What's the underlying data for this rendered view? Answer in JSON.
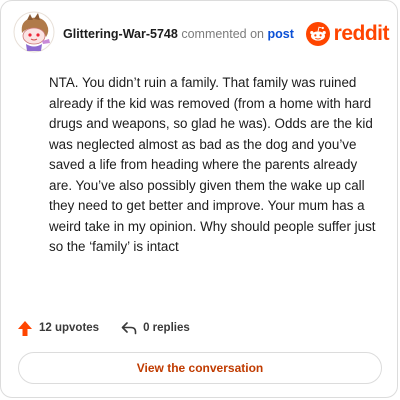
{
  "header": {
    "username": "Glittering-War-5748",
    "commented_on": "commented on",
    "post_link": "post",
    "brand": "reddit"
  },
  "comment": {
    "text": "NTA. You didn’t ruin a family. That family was ruined already if the kid was removed (from a home with hard drugs and weapons, so glad he was). Odds are the kid was neglected almost as bad as the dog and you’ve saved a life from heading where the parents already are. You’ve also possibly given them the wake up call they need to get better and improve. Your mum has a weird take in my opinion. Why should people suffer just so the ‘family’ is intact"
  },
  "actions": {
    "upvotes": "12 upvotes",
    "replies": "0 replies"
  },
  "cta": {
    "label": "View the conversation"
  },
  "colors": {
    "brand": "#ff4500",
    "link": "#0a4fd6",
    "cta_text": "#c03b00"
  }
}
